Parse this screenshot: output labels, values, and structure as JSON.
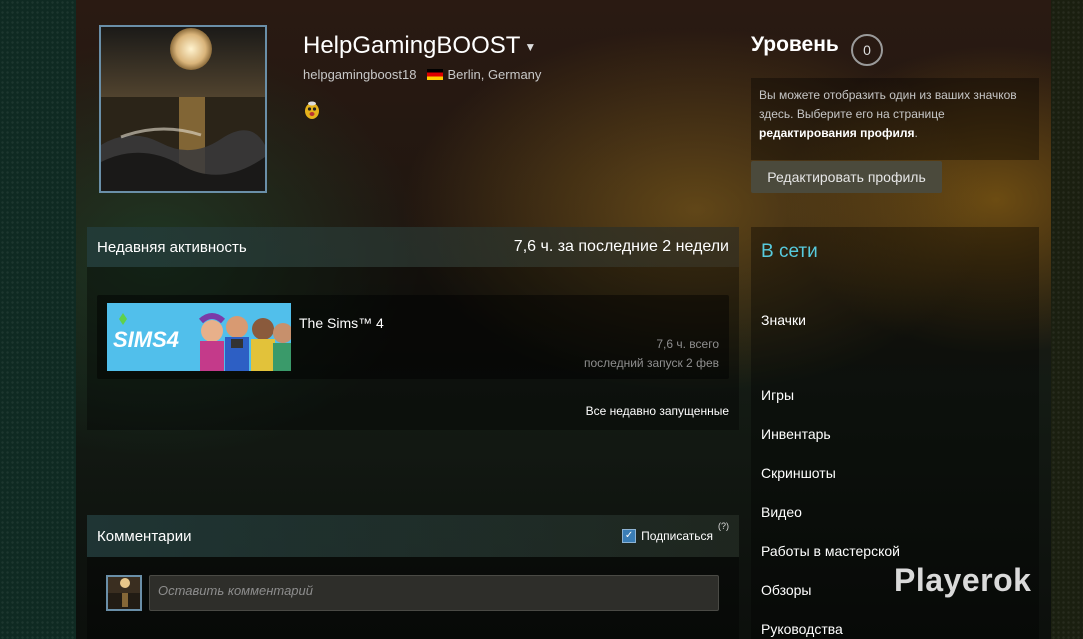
{
  "profile": {
    "name": "HelpGamingBOOST",
    "username": "helpgamingboost18",
    "location": "Berlin, Germany"
  },
  "level": {
    "title": "Уровень",
    "value": "0",
    "info_prefix": "Вы можете отобразить один из ваших значков здесь. Выберите его на странице ",
    "info_link": "редактирования профиля",
    "info_suffix": ".",
    "edit_button": "Редактировать профиль"
  },
  "activity": {
    "title": "Недавняя активность",
    "hours": "7,6 ч. за последние 2 недели",
    "game": {
      "name": "The Sims™ 4",
      "hours_total": "7,6 ч. всего",
      "last_played": "последний запуск 2 фев"
    },
    "all_recent": "Все недавно запущенные"
  },
  "comments": {
    "title": "Комментарии",
    "subscribe": "Подписаться",
    "help": "(?)",
    "placeholder": "Оставить комментарий"
  },
  "sidebar": {
    "online": "В сети",
    "items": [
      {
        "label": "Значки"
      },
      {
        "label": "Игры"
      },
      {
        "label": "Инвентарь"
      },
      {
        "label": "Скриншоты"
      },
      {
        "label": "Видео"
      },
      {
        "label": "Работы в мастерской"
      },
      {
        "label": "Обзоры"
      },
      {
        "label": "Руководства"
      }
    ]
  },
  "watermark": "Playerok",
  "colors": {
    "accent_online": "#57cbde",
    "button_bg": "#4b4a3c"
  }
}
